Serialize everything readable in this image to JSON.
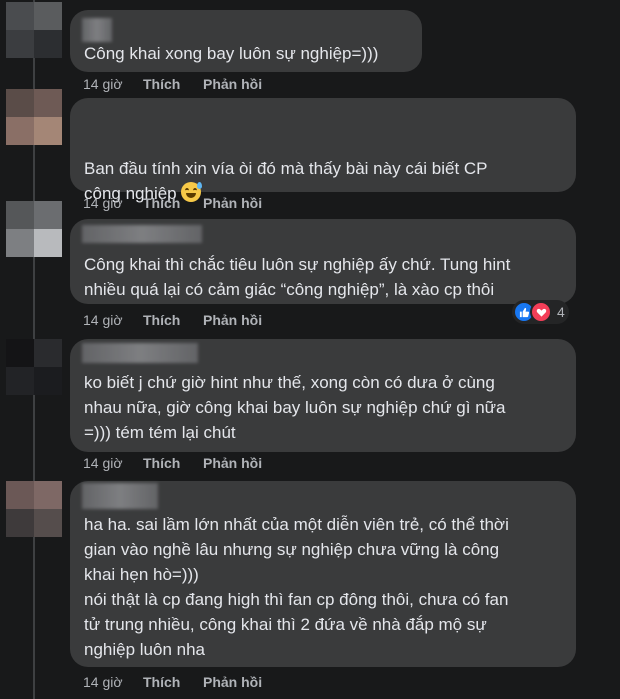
{
  "colors": {
    "bubble": "#3a3b3c",
    "background": "#18191a",
    "text": "#e4e6eb",
    "meta": "#b0b3b8",
    "like": "#1877f2",
    "love": "#f33e58"
  },
  "comments": [
    {
      "text": "Công khai xong bay luôn sự nghiệp=)))",
      "time": "14 giờ",
      "like": "Thích",
      "reply": "Phản hồi"
    },
    {
      "text": "Ban đầu tính xin vía òi đó mà thấy bài này cái biết CP\ncông nghiệp",
      "emoji": "grinning-sweat-emoji",
      "time": "14 giờ",
      "like": "Thích",
      "reply": "Phản hồi"
    },
    {
      "text": "Công khai thì chắc tiêu luôn sự nghiệp ấy chứ. Tung hint\nnhiều quá lại có cảm giác “công nghiệp”, là xào cp thôi",
      "time": "14 giờ",
      "like": "Thích",
      "reply": "Phản hồi",
      "reactions": {
        "icons": [
          "like-reaction-icon",
          "love-reaction-icon"
        ],
        "count": "4"
      }
    },
    {
      "text": "ko biết j chứ giờ hint như thế, xong còn có dưa ở cùng\nnhau nữa, giờ công khai bay luôn sự nghiệp chứ gì nữa\n=))) tém tém lại chút",
      "time": "14 giờ",
      "like": "Thích",
      "reply": "Phản hồi"
    },
    {
      "text": "ha ha. sai lầm lớn nhất của một diễn viên trẻ, có thể thời\ngian vào nghề lâu nhưng sự nghiệp chưa vững là công\nkhai hẹn hò=)))\nnói thật là cp đang high thì fan cp đông thôi, chưa có fan\ntử trung nhiều, công khai thì 2 đứa về nhà đắp mộ sự\nnghiệp luôn nha",
      "time": "14 giờ",
      "like": "Thích",
      "reply": "Phản hồi"
    }
  ]
}
